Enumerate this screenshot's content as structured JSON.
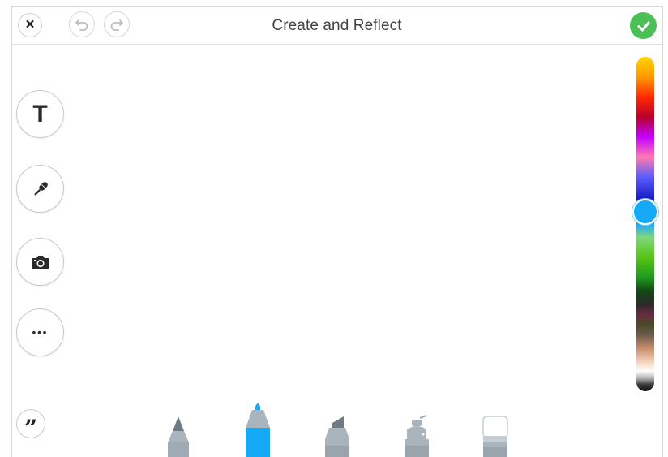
{
  "header": {
    "title": "Create and Reflect",
    "close_symbol": "×",
    "undo_icon": "undo-icon",
    "redo_icon": "redo-icon",
    "done_icon": "check-icon"
  },
  "side_tools": {
    "text_symbol": "T",
    "microphone_icon": "microphone-icon",
    "camera_icon": "camera-icon",
    "more_symbol": "•••",
    "quote_symbol": "”"
  },
  "color_palette": {
    "selected_color": "#16a9f5",
    "accent_green": "#4cbf57"
  },
  "drawing_tools": [
    {
      "name": "pencil",
      "icon": "pencil-icon",
      "selected": false
    },
    {
      "name": "marker",
      "icon": "marker-icon",
      "selected": true,
      "color": "#16a9f5"
    },
    {
      "name": "highlighter",
      "icon": "highlighter-icon",
      "selected": false
    },
    {
      "name": "spray",
      "icon": "spray-icon",
      "selected": false
    },
    {
      "name": "eraser",
      "icon": "eraser-icon",
      "selected": false
    }
  ]
}
